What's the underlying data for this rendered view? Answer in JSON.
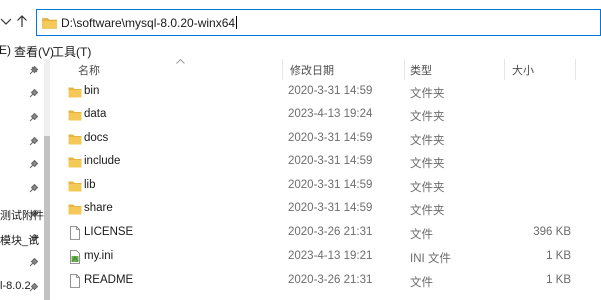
{
  "address": {
    "path": "D:\\software\\mysql-8.0.20-winx64"
  },
  "menu": [
    {
      "label": "E)"
    },
    {
      "label": "查看(V)"
    },
    {
      "label": "工具(T)"
    }
  ],
  "nav_pane": {
    "labels": [
      "测试附件",
      "模块_试",
      "l-8.0.2"
    ]
  },
  "columns": {
    "name": "名称",
    "date": "修改日期",
    "type": "类型",
    "size": "大小"
  },
  "files": [
    {
      "name": "bin",
      "date": "2020-3-31 14:59",
      "type": "文件夹",
      "size": "",
      "icon": "folder-icon"
    },
    {
      "name": "data",
      "date": "2023-4-13 19:24",
      "type": "文件夹",
      "size": "",
      "icon": "folder-icon"
    },
    {
      "name": "docs",
      "date": "2020-3-31 14:59",
      "type": "文件夹",
      "size": "",
      "icon": "folder-icon"
    },
    {
      "name": "include",
      "date": "2020-3-31 14:59",
      "type": "文件夹",
      "size": "",
      "icon": "folder-icon"
    },
    {
      "name": "lib",
      "date": "2020-3-31 14:59",
      "type": "文件夹",
      "size": "",
      "icon": "folder-icon"
    },
    {
      "name": "share",
      "date": "2020-3-31 14:59",
      "type": "文件夹",
      "size": "",
      "icon": "folder-icon"
    },
    {
      "name": "LICENSE",
      "date": "2020-3-26 21:31",
      "type": "文件",
      "size": "396 KB",
      "icon": "file-icon"
    },
    {
      "name": "my.ini",
      "date": "2023-4-13 19:21",
      "type": "INI 文件",
      "size": "1 KB",
      "icon": "ini-file-icon"
    },
    {
      "name": "README",
      "date": "2020-3-26 21:31",
      "type": "文件",
      "size": "1 KB",
      "icon": "file-icon"
    }
  ],
  "colors": {
    "folder": "#e8b440",
    "accent": "#0078d7"
  }
}
